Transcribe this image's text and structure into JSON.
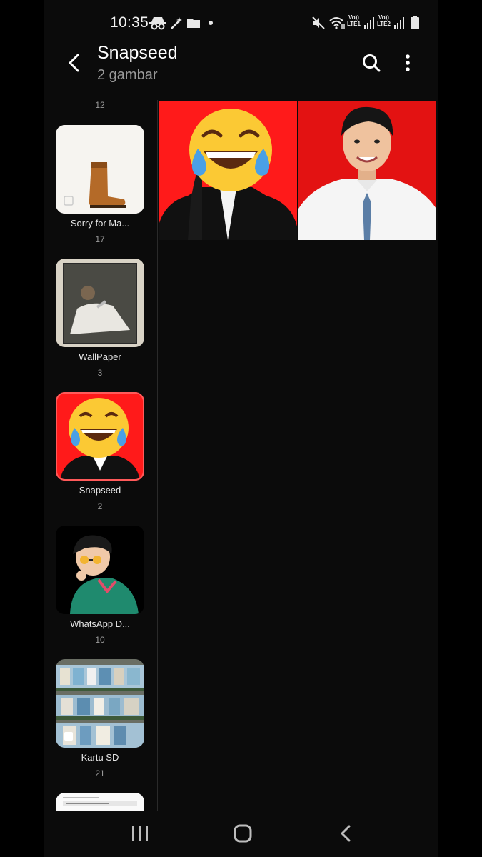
{
  "status_bar": {
    "time": "10:35",
    "sim1_label": "Vo))\nLTE1",
    "sim2_label": "Vo))\nLTE2"
  },
  "app_bar": {
    "title": "Snapseed",
    "subtitle": "2 gambar",
    "icons": [
      "back-arrow-icon",
      "search-icon",
      "more-vert-icon"
    ]
  },
  "albums": {
    "top_partial_count": "12",
    "items": [
      {
        "name": "Sorry for Ma...",
        "count": "17",
        "thumb": "boot"
      },
      {
        "name": "WallPaper",
        "count": "3",
        "thumb": "photo"
      },
      {
        "name": "Snapseed",
        "count": "2",
        "thumb": "emoji",
        "selected": true
      },
      {
        "name": "WhatsApp D...",
        "count": "10",
        "thumb": "illustration"
      },
      {
        "name": "Kartu SD",
        "count": "21",
        "thumb": "shelves"
      }
    ]
  },
  "grid": {
    "items": [
      {
        "label": "emoji-face-photo",
        "background": "#ff1a1a"
      },
      {
        "label": "student-portrait-photo",
        "background": "#e31212"
      }
    ]
  },
  "colors": {
    "background": "#0b0b0b",
    "accent_red": "#ff2020",
    "selected_outline": "#ff5a5a",
    "muted_text": "#9a9a9a"
  },
  "nav_bar": {
    "icons": [
      "recents-icon",
      "home-icon",
      "back-icon"
    ]
  }
}
